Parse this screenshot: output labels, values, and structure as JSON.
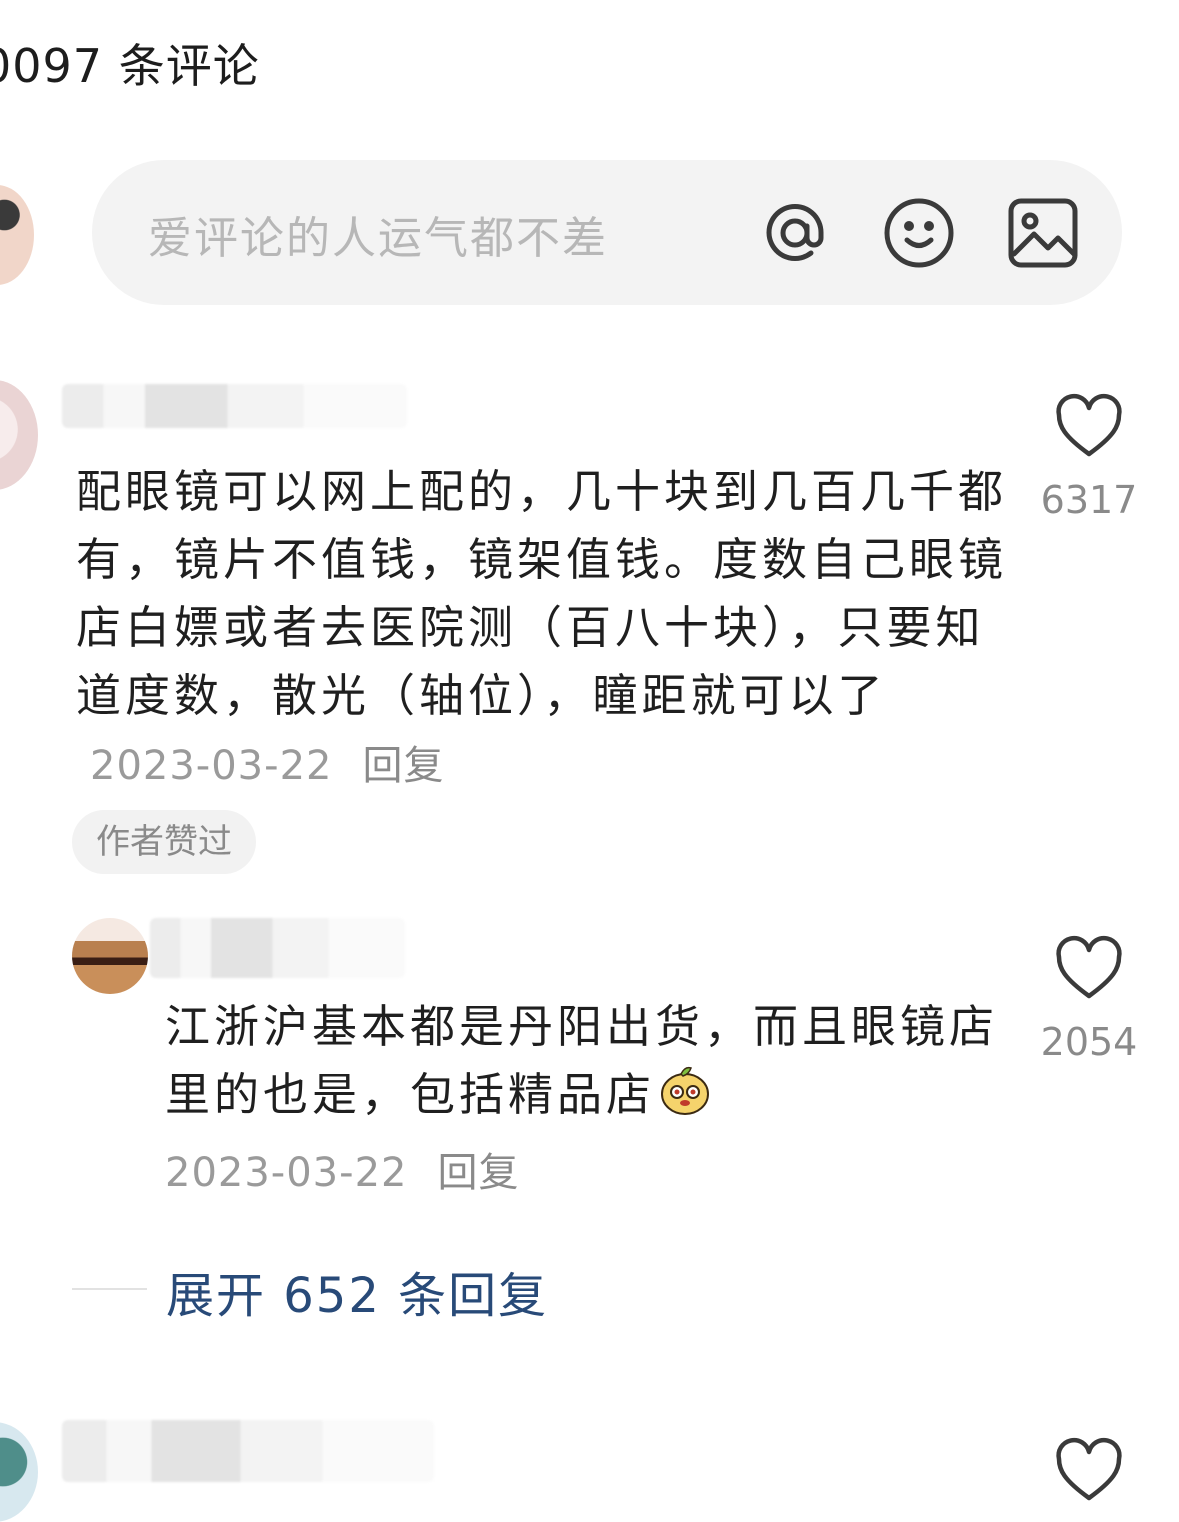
{
  "header": {
    "title": "0097 条评论"
  },
  "composer": {
    "placeholder": "爱评论的人运气都不差",
    "icons": [
      "at-icon",
      "emoji-icon",
      "image-icon"
    ]
  },
  "comments": [
    {
      "text": "配眼镜可以网上配的，几十块到几百几千都有，镜片不值钱，镜架值钱。度数自己眼镜店白嫖或者去医院测（百八十块），只要知道度数，散光（轴位），瞳距就可以了",
      "date": "2023-03-22",
      "reply_label": "回复",
      "badge": "作者赞过",
      "likes": "6317"
    },
    {
      "text": "江浙沪基本都是丹阳出货，而且眼镜店里的也是，包括精品店",
      "date": "2023-03-22",
      "reply_label": "回复",
      "likes": "2054"
    }
  ],
  "expand": {
    "label": "展开 652 条回复"
  },
  "colors": {
    "link": "#284a78",
    "muted": "#9a9a9a",
    "pill_bg": "#f3f3f3"
  }
}
